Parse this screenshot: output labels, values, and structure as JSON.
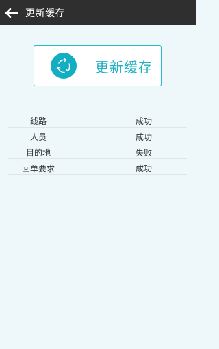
{
  "header": {
    "title": "更新缓存"
  },
  "refresh": {
    "label": "更新缓存"
  },
  "cache_items": [
    {
      "name": "线路",
      "status": "成功"
    },
    {
      "name": "人员",
      "status": "成功"
    },
    {
      "name": "目的地",
      "status": "失败"
    },
    {
      "name": "回单要求",
      "status": "成功"
    }
  ],
  "colors": {
    "topbar": "#2f2f2f",
    "accent": "#14aec3",
    "background": "#eef8fa"
  }
}
